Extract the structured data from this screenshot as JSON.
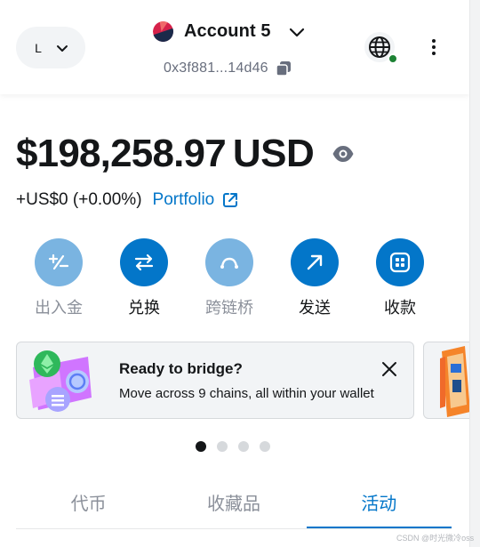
{
  "header": {
    "network_letter": "L",
    "account_name": "Account 5",
    "address": "0x3f881...14d46"
  },
  "balance": {
    "amount": "$198,258.97",
    "currency": "USD",
    "change": "+US$0 (+0.00%)",
    "portfolio_label": "Portfolio"
  },
  "actions": [
    {
      "label": "出入金",
      "icon": "plus-minus-icon",
      "state": "disabled"
    },
    {
      "label": "兑换",
      "icon": "swap-arrows-icon",
      "state": "active"
    },
    {
      "label": "跨链桥",
      "icon": "bridge-icon",
      "state": "disabled"
    },
    {
      "label": "发送",
      "icon": "arrow-up-right-icon",
      "state": "active"
    },
    {
      "label": "收款",
      "icon": "qr-code-icon",
      "state": "active"
    }
  ],
  "banner": {
    "title": "Ready to bridge?",
    "text": "Move across 9 chains, all within your wallet"
  },
  "carousel": {
    "count": 4,
    "active_index": 0
  },
  "tabs": [
    "代币",
    "收藏品",
    "活动"
  ],
  "active_tab": 2,
  "watermark": "CSDN @时光微冷oss",
  "colors": {
    "primary": "#0376c9",
    "primary_disabled": "#7ab4e1",
    "text": "#141618",
    "muted": "#686e7d",
    "status_green": "#1c8234"
  }
}
